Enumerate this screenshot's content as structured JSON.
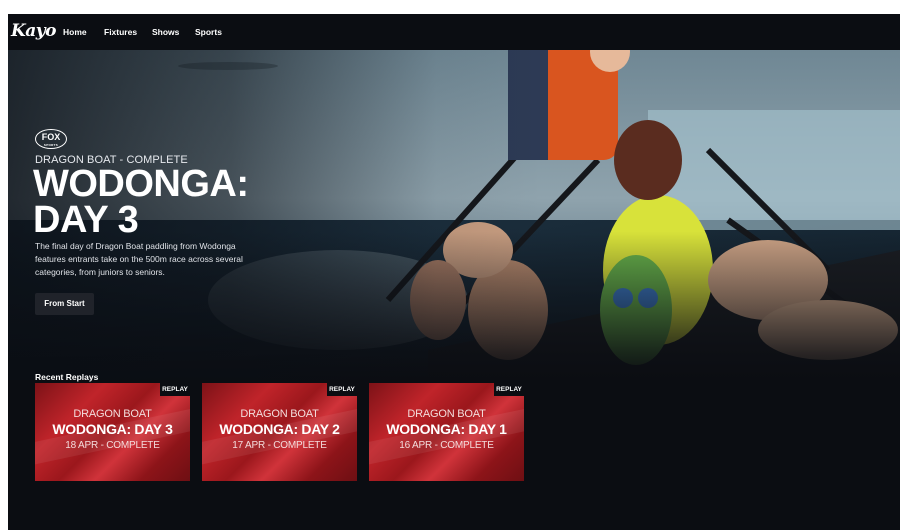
{
  "nav": {
    "logo": "Kayo",
    "links": [
      "Home",
      "Fixtures",
      "Shows",
      "Sports"
    ]
  },
  "hero": {
    "channel_logo": "FOX",
    "channel_logo_sub": "SPORTS",
    "category": "DRAGON BOAT - COMPLETE",
    "title_line1": "WODONGA:",
    "title_line2": "DAY 3",
    "description": "The final day of Dragon Boat paddling from Wodonga features entrants take on the 500m race across several categories, from juniors to seniors.",
    "button_label": "From Start"
  },
  "replays": {
    "section_title": "Recent Replays",
    "items": [
      {
        "badge": "REPLAY",
        "sport": "DRAGON BOAT",
        "title": "WODONGA: DAY 3",
        "subtitle": "18 APR - COMPLETE"
      },
      {
        "badge": "REPLAY",
        "sport": "DRAGON BOAT",
        "title": "WODONGA: DAY 2",
        "subtitle": "17 APR - COMPLETE"
      },
      {
        "badge": "REPLAY",
        "sport": "DRAGON BOAT",
        "title": "WODONGA: DAY 1",
        "subtitle": "16 APR - COMPLETE"
      }
    ]
  },
  "colors": {
    "background": "#0b0d12",
    "card_red": "#b81f25",
    "text": "#ffffff"
  }
}
